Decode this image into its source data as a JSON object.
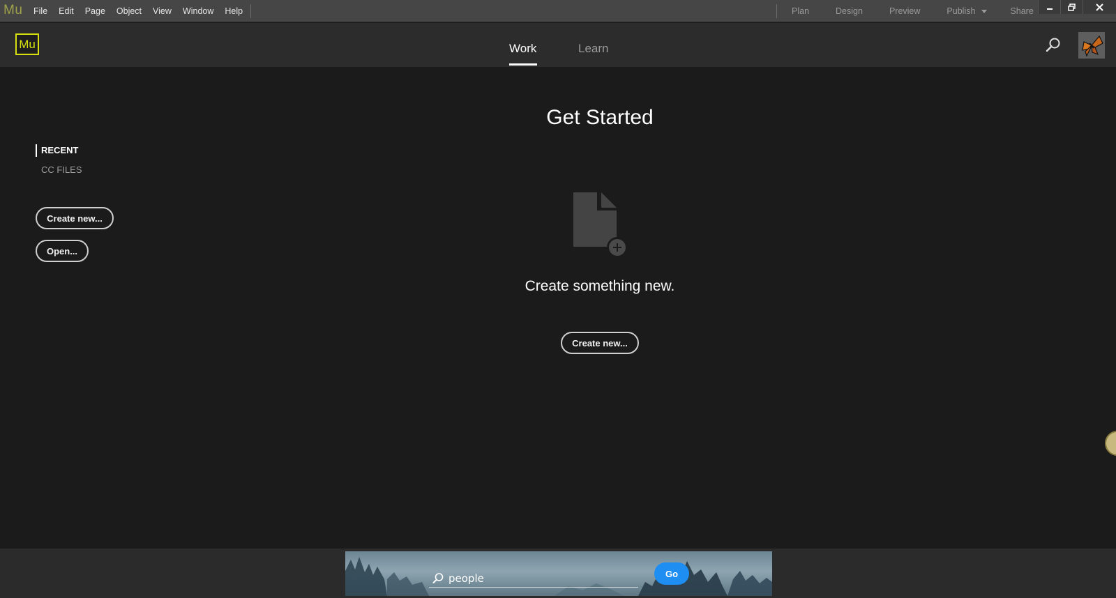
{
  "app": {
    "badge": "Mu"
  },
  "menubar": {
    "items": [
      "File",
      "Edit",
      "Page",
      "Object",
      "View",
      "Window",
      "Help"
    ],
    "modes": {
      "plan": "Plan",
      "design": "Design",
      "preview": "Preview",
      "publish": "Publish",
      "share": "Share"
    }
  },
  "header": {
    "logo": "Mu",
    "tabs": {
      "work": "Work",
      "learn": "Learn"
    },
    "active_tab": "Work"
  },
  "sidebar": {
    "items": [
      "RECENT",
      "CC FILES"
    ],
    "active": "RECENT",
    "create_label": "Create new...",
    "open_label": "Open..."
  },
  "main": {
    "title": "Get Started",
    "empty_message": "Create something new.",
    "create_label": "Create new..."
  },
  "stock": {
    "search_value": "people",
    "go_label": "Go"
  },
  "colors": {
    "accent_mu": "#d6e010",
    "go_button": "#1e8ef2",
    "background": "#1b1b1b"
  },
  "icons": {
    "search": "search-icon",
    "new_document": "document-plus-icon",
    "minimize": "minimize-icon",
    "restore": "restore-icon",
    "close": "close-icon"
  }
}
